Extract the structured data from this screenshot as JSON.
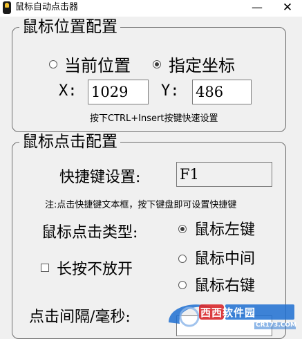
{
  "window": {
    "title": "鼠标自动点击器",
    "minimize_glyph": "—",
    "close_glyph": "✕"
  },
  "position_group": {
    "legend": "鼠标位置配置",
    "options": [
      {
        "label": "当前位置",
        "checked": false
      },
      {
        "label": "指定坐标",
        "checked": true
      }
    ],
    "x_label": "X:",
    "x_value": "1029",
    "y_label": "Y:",
    "y_value": "486",
    "hint": "按下CTRL+Insert按键快速设置"
  },
  "click_group": {
    "legend": "鼠标点击配置",
    "hotkey_label": "快捷键设置:",
    "hotkey_value": "F1",
    "note": "注:点击快捷键文本框，按下键盘即可设置快捷键",
    "click_type_label": "鼠标点击类型:",
    "button_options": [
      {
        "label": "鼠标左键",
        "checked": true
      },
      {
        "label": "鼠标中间",
        "checked": false
      },
      {
        "label": "鼠标右键",
        "checked": false
      }
    ],
    "long_press_label": "长按不放开",
    "long_press_checked": false,
    "interval_label": "点击间隔/毫秒:"
  },
  "watermark": {
    "brand": "西西软件园",
    "url": "CR173.COM",
    "colors": {
      "red": "#d8282b",
      "blue": "#1d6fd1"
    }
  }
}
